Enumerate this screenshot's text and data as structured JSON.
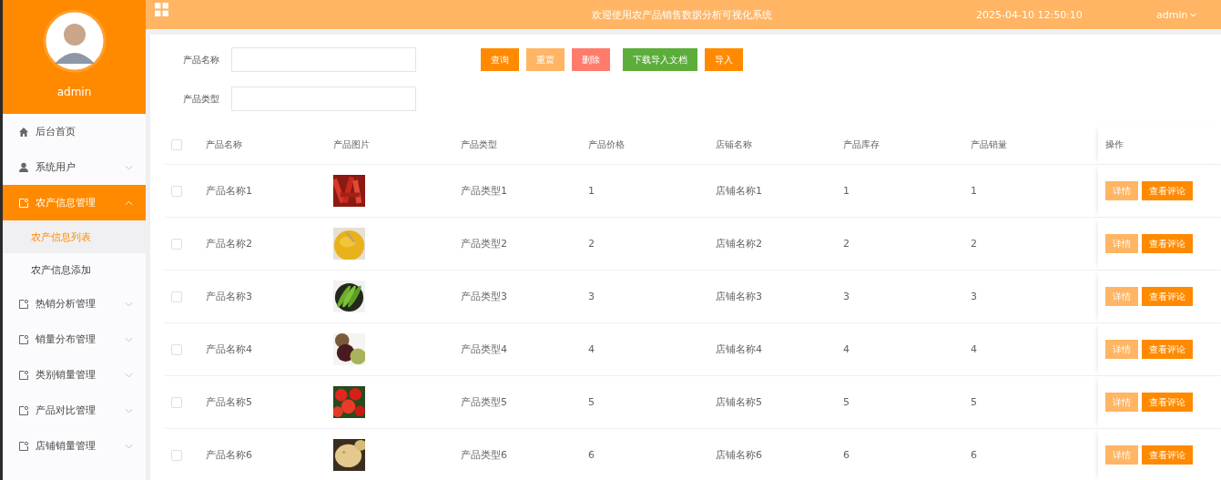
{
  "header": {
    "title": "欢迎使用农产品销售数据分析可视化系统",
    "datetime": "2025-04-10 12:50:10",
    "user": "admin"
  },
  "sidebar": {
    "username": "admin",
    "items": [
      {
        "label": "后台首页",
        "kind": "link",
        "selected": false
      },
      {
        "label": "系统用户",
        "kind": "group",
        "selected": false,
        "expanded": false
      },
      {
        "label": "农产信息管理",
        "kind": "group",
        "selected": true,
        "expanded": true,
        "children": [
          {
            "label": "农产信息列表",
            "selected": true
          },
          {
            "label": "农产信息添加",
            "selected": false
          }
        ]
      },
      {
        "label": "热销分析管理",
        "kind": "group",
        "selected": false,
        "expanded": false
      },
      {
        "label": "销量分布管理",
        "kind": "group",
        "selected": false,
        "expanded": false
      },
      {
        "label": "类别销量管理",
        "kind": "group",
        "selected": false,
        "expanded": false
      },
      {
        "label": "产品对比管理",
        "kind": "group",
        "selected": false,
        "expanded": false
      },
      {
        "label": "店铺销量管理",
        "kind": "group",
        "selected": false,
        "expanded": false
      }
    ]
  },
  "search": {
    "fields": [
      {
        "label": "产品名称"
      },
      {
        "label": "产品类型"
      }
    ],
    "buttons": [
      {
        "label": "查询",
        "kind": "primary"
      },
      {
        "label": "重置",
        "kind": "light"
      },
      {
        "label": "删除",
        "kind": "danger"
      },
      {
        "label": "下载导入文档",
        "kind": "success"
      },
      {
        "label": "导入",
        "kind": "primary"
      }
    ]
  },
  "table": {
    "columns": [
      "产品名称",
      "产品图片",
      "产品类型",
      "产品价格",
      "店铺名称",
      "产品库存",
      "产品销量",
      "操作"
    ],
    "header_checked": false,
    "rows": [
      {
        "checked": false,
        "name": "产品名称1",
        "type": "产品类型1",
        "price": "1",
        "shop": "店铺名称1",
        "stock": "1",
        "sales": "1",
        "actions": [
          "详情",
          "查看评论"
        ]
      },
      {
        "checked": false,
        "name": "产品名称2",
        "type": "产品类型2",
        "price": "2",
        "shop": "店铺名称2",
        "stock": "2",
        "sales": "2",
        "actions": [
          "详情",
          "查看评论"
        ]
      },
      {
        "checked": false,
        "name": "产品名称3",
        "type": "产品类型3",
        "price": "3",
        "shop": "店铺名称3",
        "stock": "3",
        "sales": "3",
        "actions": [
          "详情",
          "查看评论"
        ]
      },
      {
        "checked": false,
        "name": "产品名称4",
        "type": "产品类型4",
        "price": "4",
        "shop": "店铺名称4",
        "stock": "4",
        "sales": "4",
        "actions": [
          "详情",
          "查看评论"
        ]
      },
      {
        "checked": false,
        "name": "产品名称5",
        "type": "产品类型5",
        "price": "5",
        "shop": "店铺名称5",
        "stock": "5",
        "sales": "5",
        "actions": [
          "详情",
          "查看评论"
        ]
      },
      {
        "checked": false,
        "name": "产品名称6",
        "type": "产品类型6",
        "price": "6",
        "shop": "店铺名称6",
        "stock": "6",
        "sales": "6",
        "actions": [
          "详情",
          "查看评论"
        ]
      }
    ]
  }
}
